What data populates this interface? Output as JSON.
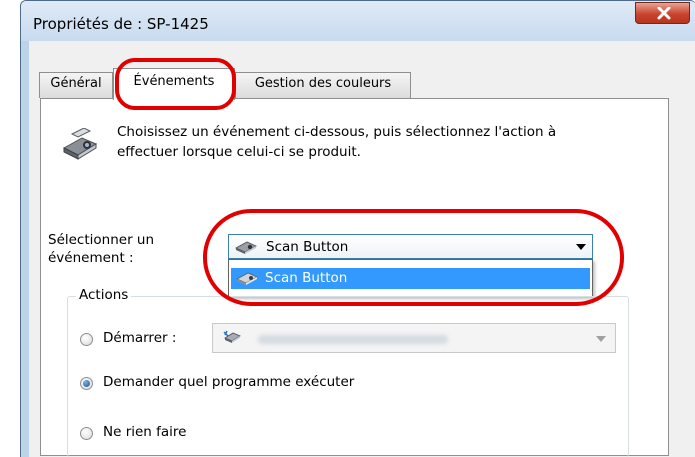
{
  "window": {
    "title": "Propriétés de : SP-1425",
    "close_symbol": "X"
  },
  "tabs": [
    {
      "label": "Général",
      "active": false
    },
    {
      "label": "Événements",
      "active": true
    },
    {
      "label": "Gestion des couleurs",
      "active": false
    }
  ],
  "description": "Choisissez un événement ci-dessous, puis sélectionnez l'action à effectuer lorsque celui-ci se produit.",
  "event_select": {
    "label_line1": "Sélectionner un",
    "label_line2": "événement :",
    "selected": "Scan Button",
    "options": [
      "Scan Button"
    ]
  },
  "actions": {
    "group_label": "Actions",
    "start_label": "Démarrer :",
    "ask_label": "Demander quel programme exécuter",
    "nothing_label": "Ne rien faire",
    "selected": "ask"
  },
  "colors": {
    "annotation": "#e00000",
    "selection": "#3399ff"
  },
  "icons": {
    "scanner": "scanner-icon",
    "close": "close-icon"
  }
}
